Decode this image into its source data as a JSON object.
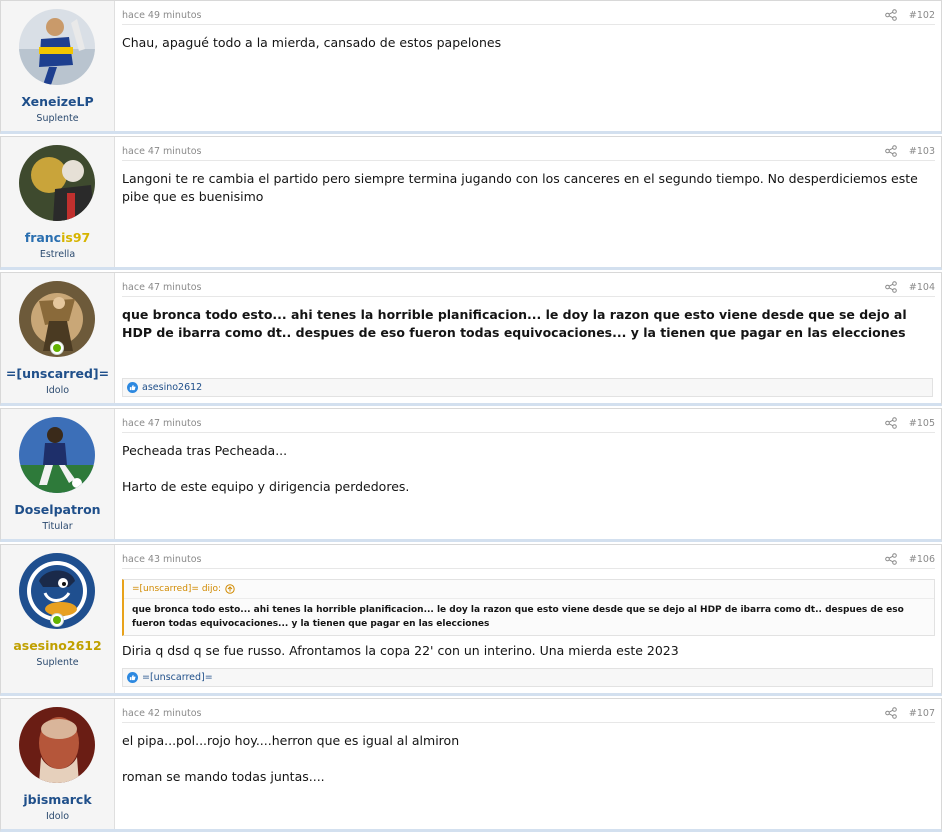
{
  "posts": [
    {
      "author": "XeneizeLP",
      "title": "Suplente",
      "time": "hace 49 minutos",
      "number": "#102",
      "paragraphs": [
        "Chau, apagué todo a la mierda, cansado de estos papelones"
      ]
    },
    {
      "author": "francis97",
      "title": "Estrella",
      "time": "hace 47 minutos",
      "number": "#103",
      "paragraphs": [
        "Langoni te re cambia el partido pero siempre termina jugando con los canceres en el segundo tiempo. No desperdiciemos este pibe que es buenisimo"
      ]
    },
    {
      "author": "=[unscarred]=",
      "title": "Idolo",
      "time": "hace 47 minutos",
      "number": "#104",
      "paragraphs": [
        "que bronca todo esto... ahi tenes la horrible planificacion... le doy la razon que esto viene desde que se dejo al HDP de ibarra como dt.. despues de eso fueron todas equivocaciones... y la tienen que pagar en las elecciones"
      ],
      "reaction": "asesino2612"
    },
    {
      "author": "Doselpatron",
      "title": "Titular",
      "time": "hace 47 minutos",
      "number": "#105",
      "paragraphs": [
        "Pecheada tras Pecheada...",
        "Harto de este equipo y dirigencia perdedores."
      ]
    },
    {
      "author": "asesino2612",
      "title": "Suplente",
      "time": "hace 43 minutos",
      "number": "#106",
      "quote": {
        "head": "=[unscarred]= dijo:",
        "text": "que bronca todo esto... ahi tenes la horrible planificacion... le doy la razon que esto viene desde que se dejo al HDP de ibarra como dt.. despues de eso fueron todas equivocaciones... y la tienen que pagar en las elecciones"
      },
      "paragraphs": [
        "Diria q dsd q se fue russo. Afrontamos la copa 22' con un interino. Una mierda este 2023"
      ],
      "reaction": "=[unscarred]="
    },
    {
      "author": "jbismarck",
      "title": "Idolo",
      "time": "hace 42 minutos",
      "number": "#107",
      "paragraphs": [
        "el pipa...pol...rojo hoy....herron que es igual al almiron",
        "roman se mando todas juntas...."
      ]
    }
  ],
  "icons": {
    "share": "share-icon",
    "like": "like-icon",
    "online": "online-indicator",
    "quote_arrow": "arrow-up-circle-icon"
  },
  "colors": {
    "username": "#1f4f8a",
    "accent_border": "#d3e0ef",
    "quote_accent": "#e8a21a"
  }
}
